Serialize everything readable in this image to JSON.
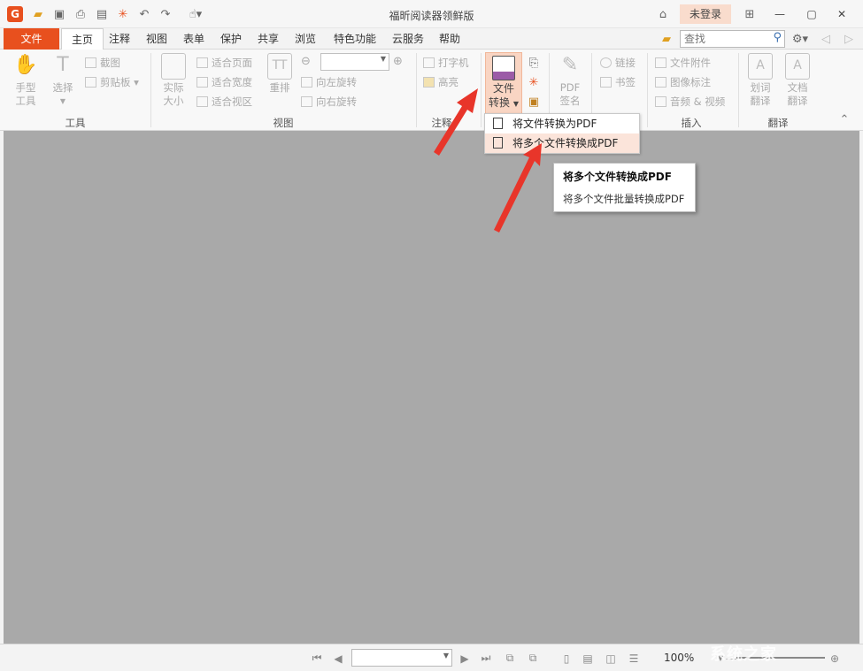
{
  "window": {
    "title": "福昕阅读器领鲜版",
    "logo_letter": "G",
    "login_label": "未登录"
  },
  "quick_access": [
    {
      "name": "open-folder-icon"
    },
    {
      "name": "save-icon"
    },
    {
      "name": "print-icon"
    },
    {
      "name": "scan-icon"
    },
    {
      "name": "new-icon"
    },
    {
      "name": "undo-icon"
    },
    {
      "name": "redo-icon"
    },
    {
      "name": "hand-tool-icon"
    }
  ],
  "tabs": {
    "file": "文件",
    "items": [
      "主页",
      "注释",
      "视图",
      "表单",
      "保护",
      "共享",
      "浏览",
      "特色功能",
      "云服务",
      "帮助"
    ],
    "active_index": 0
  },
  "search": {
    "placeholder": "查找"
  },
  "ribbon": {
    "tools_group": {
      "label": "工具",
      "hand_tool": "手型\n工具",
      "select_tool": "选择",
      "screenshot": "截图",
      "clipboard": "剪贴板"
    },
    "view_group": {
      "label": "视图",
      "actual_size": "实际\n大小",
      "fit_page": "适合页面",
      "fit_width": "适合宽度",
      "fit_visible": "适合视区",
      "reflow": "重排",
      "rotate_left": "向左旋转",
      "rotate_right": "向右旋转"
    },
    "annotate_group": {
      "label": "注释",
      "typewriter": "打字机",
      "highlight": "高亮"
    },
    "convert_button": "文件\n转换",
    "sign_group": {
      "pdf_sign": "PDF\n签名"
    },
    "links_group": {
      "link": "链接",
      "bookmark": "书签"
    },
    "insert_group": {
      "label": "插入",
      "attachment": "文件附件",
      "image_annotation": "图像标注",
      "audio_video": "音频 & 视频"
    },
    "translate_group": {
      "label": "翻译",
      "word_translate": "划词\n翻译",
      "doc_translate": "文档\n翻译"
    }
  },
  "convert_menu": {
    "items": [
      "将文件转换为PDF",
      "将多个文件转换成PDF"
    ],
    "highlighted_index": 1
  },
  "tooltip": {
    "title": "将多个文件转换成PDF",
    "body": "将多个文件批量转换成PDF"
  },
  "status_bar": {
    "zoom": "100%"
  },
  "colors": {
    "accent": "#e8501e",
    "workspace": "#a9a9a9",
    "menu_highlight": "#fbe4da",
    "arrow": "#e8352a"
  },
  "watermark": "系统之家"
}
